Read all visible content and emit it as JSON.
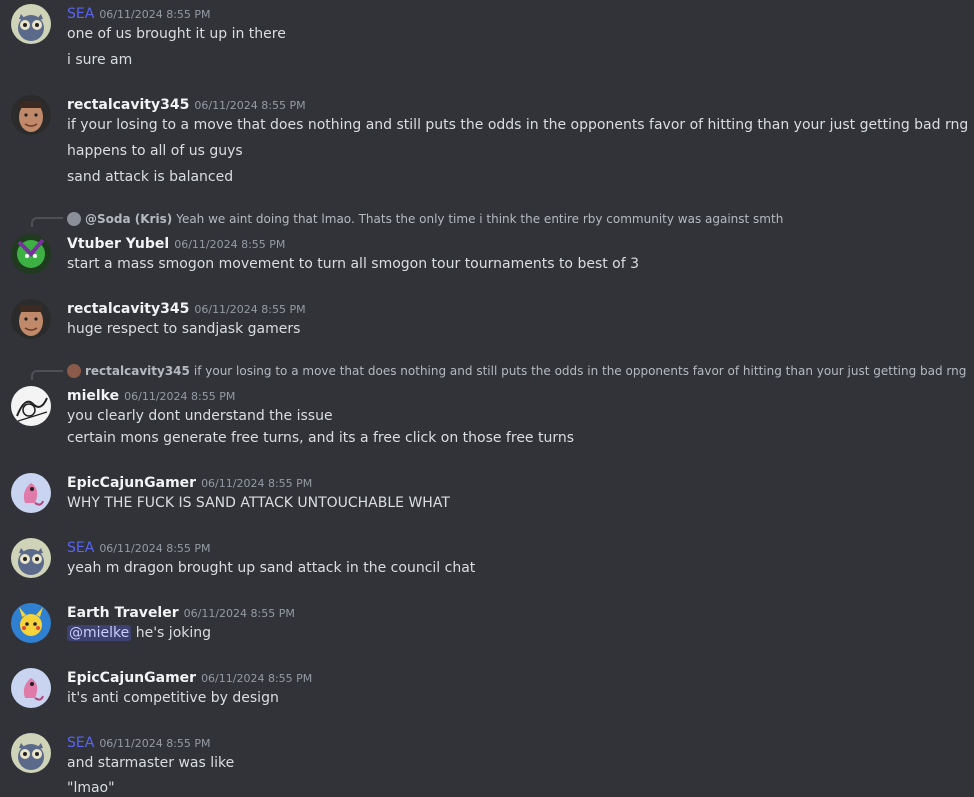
{
  "channel": {
    "messages": [
      {
        "author": "SEA",
        "timestamp": "06/11/2024 8:55 PM",
        "avatar": "owl-avatar",
        "lines": [
          "one of us brought it up in there",
          "i sure am"
        ]
      },
      {
        "author": "rectalcavity345",
        "timestamp": "06/11/2024 8:55 PM",
        "avatar": "face-avatar",
        "lines": [
          "if your losing to a move that does nothing and still puts the odds in the opponents favor of hitting than your just getting bad rng",
          "happens to all of us guys",
          "sand attack is balanced"
        ]
      },
      {
        "author": "Vtuber Yubel",
        "timestamp": "06/11/2024 8:55 PM",
        "avatar": "green-character-avatar",
        "reply": {
          "name": "@Soda (Kris)",
          "text": "Yeah we aint doing that lmao. Thats the only time i think the entire rby community was against smth"
        },
        "lines": [
          "start a mass smogon movement to turn all smogon tour tournaments to best of 3"
        ]
      },
      {
        "author": "rectalcavity345",
        "timestamp": "06/11/2024 8:55 PM",
        "avatar": "face-avatar",
        "lines": [
          "huge respect to sandjask gamers"
        ]
      },
      {
        "author": "mielke",
        "timestamp": "06/11/2024 8:55 PM",
        "avatar": "sketch-avatar",
        "reply": {
          "name": "rectalcavity345",
          "text": "if your losing to a move that does nothing and still puts the odds in the opponents favor of hitting than your just getting bad rng"
        },
        "lines": [
          "you clearly dont understand the issue",
          "certain mons generate free turns, and its a free click on those free turns"
        ]
      },
      {
        "author": "EpicCajunGamer",
        "timestamp": "06/11/2024 8:55 PM",
        "avatar": "pink-creature-avatar",
        "lines": [
          "WHY THE FUCK IS SAND ATTACK UNTOUCHABLE WHAT"
        ]
      },
      {
        "author": "SEA",
        "timestamp": "06/11/2024 8:55 PM",
        "avatar": "owl-avatar",
        "lines": [
          "yeah m dragon brought up sand attack in the council chat"
        ]
      },
      {
        "author": "Earth Traveler",
        "timestamp": "06/11/2024 8:55 PM",
        "avatar": "pikachu-avatar",
        "mention": "@mielke",
        "lines": [
          "he's joking"
        ]
      },
      {
        "author": "EpicCajunGamer",
        "timestamp": "06/11/2024 8:55 PM",
        "avatar": "pink-creature-avatar",
        "lines": [
          "it's anti competitive by design"
        ]
      },
      {
        "author": "SEA",
        "timestamp": "06/11/2024 8:55 PM",
        "avatar": "owl-avatar",
        "lines": [
          "and starmaster was like",
          "\"lmao\""
        ]
      }
    ]
  },
  "colors": {
    "background": "#313338",
    "text": "#dbdee1",
    "author": "#f2f3f5",
    "sea_name": "#5865f2",
    "timestamp": "#949ba4"
  }
}
